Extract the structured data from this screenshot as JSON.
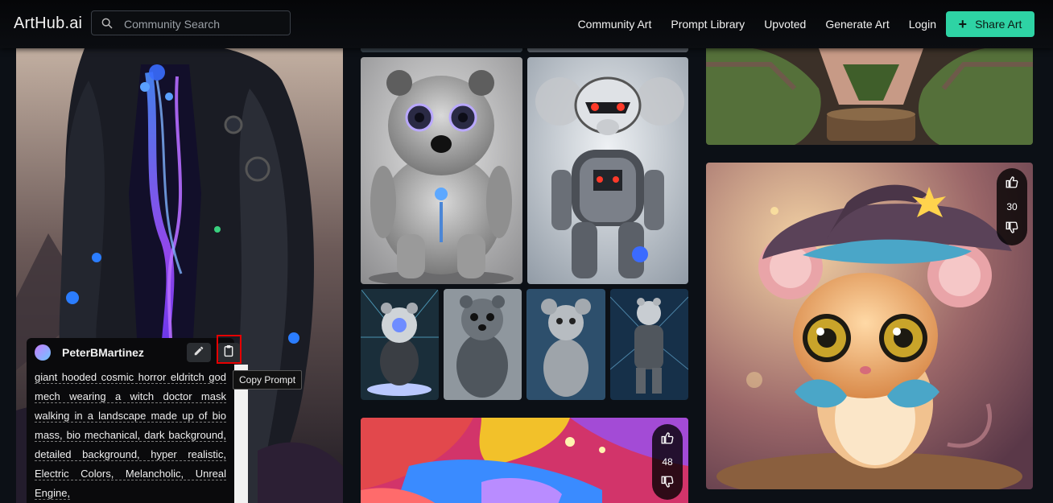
{
  "header": {
    "brand": "ArtHub.ai",
    "search_placeholder": "Community Search",
    "nav": [
      "Community Art",
      "Prompt Library",
      "Upvoted",
      "Generate Art",
      "Login"
    ],
    "share_label": "Share Art"
  },
  "card": {
    "username": "PeterBMartinez",
    "prompt_words": [
      "giant hooded cosmic horror eldritch god mech wearing a witch doctor mask walking in a landscape made up of bio mass, bio mechanical, dark background, detailed background, hyper realistic, Electric Colors, Melancholic, Unreal Engine,"
    ],
    "tooltip": "Copy Prompt"
  },
  "votes": {
    "mouse_card": "30",
    "paint_card": "48"
  },
  "icons": {
    "search": "search-icon",
    "plus": "plus-icon",
    "edit": "pencil-icon",
    "copy": "clipboard-icon",
    "upvote": "thumbs-up-icon",
    "downvote": "thumbs-down-icon"
  },
  "colors": {
    "accent": "#2ed3a4",
    "highlight": "#e60000",
    "background": "#0c1016"
  }
}
